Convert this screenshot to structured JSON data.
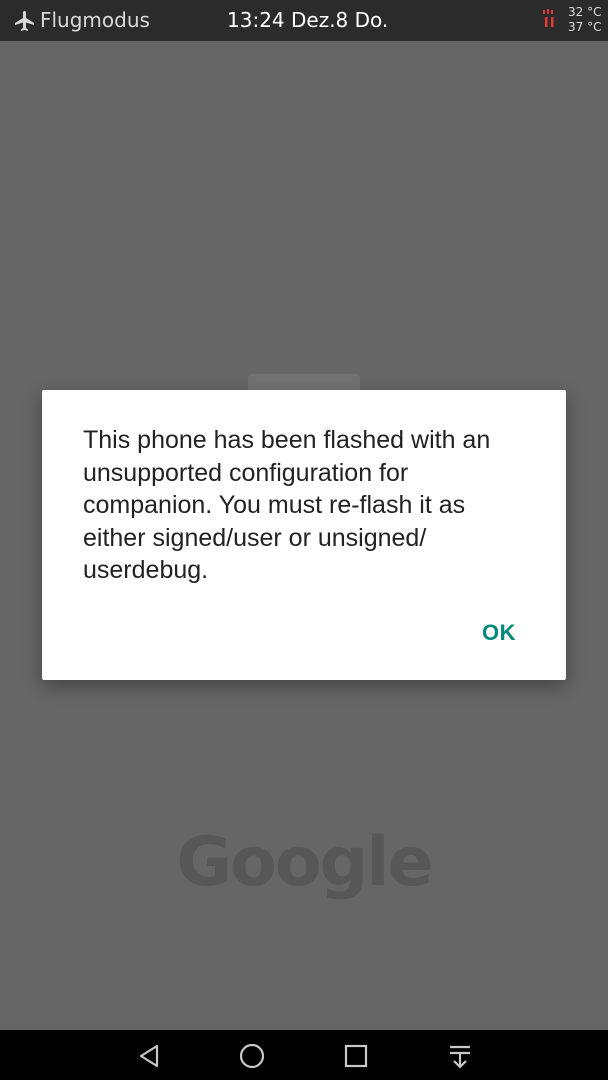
{
  "status_bar": {
    "mode": "Flugmodus",
    "clock": "13:24 Dez.8 Do.",
    "temp_1": "32 °C",
    "temp_2": "37 °C",
    "icons": [
      "airplane-icon",
      "thermometer-icon"
    ]
  },
  "background": {
    "logo_text": "Google"
  },
  "dialog": {
    "message": "This phone has been flashed with an unsupported configuration for companion. You must re-flash it as either signed/user or unsigned/ userdebug.",
    "ok_label": "OK",
    "accent_color": "#00897b"
  },
  "nav_bar": {
    "icons": [
      "back-icon",
      "home-icon",
      "recent-apps-icon",
      "notification-drawer-icon"
    ]
  }
}
